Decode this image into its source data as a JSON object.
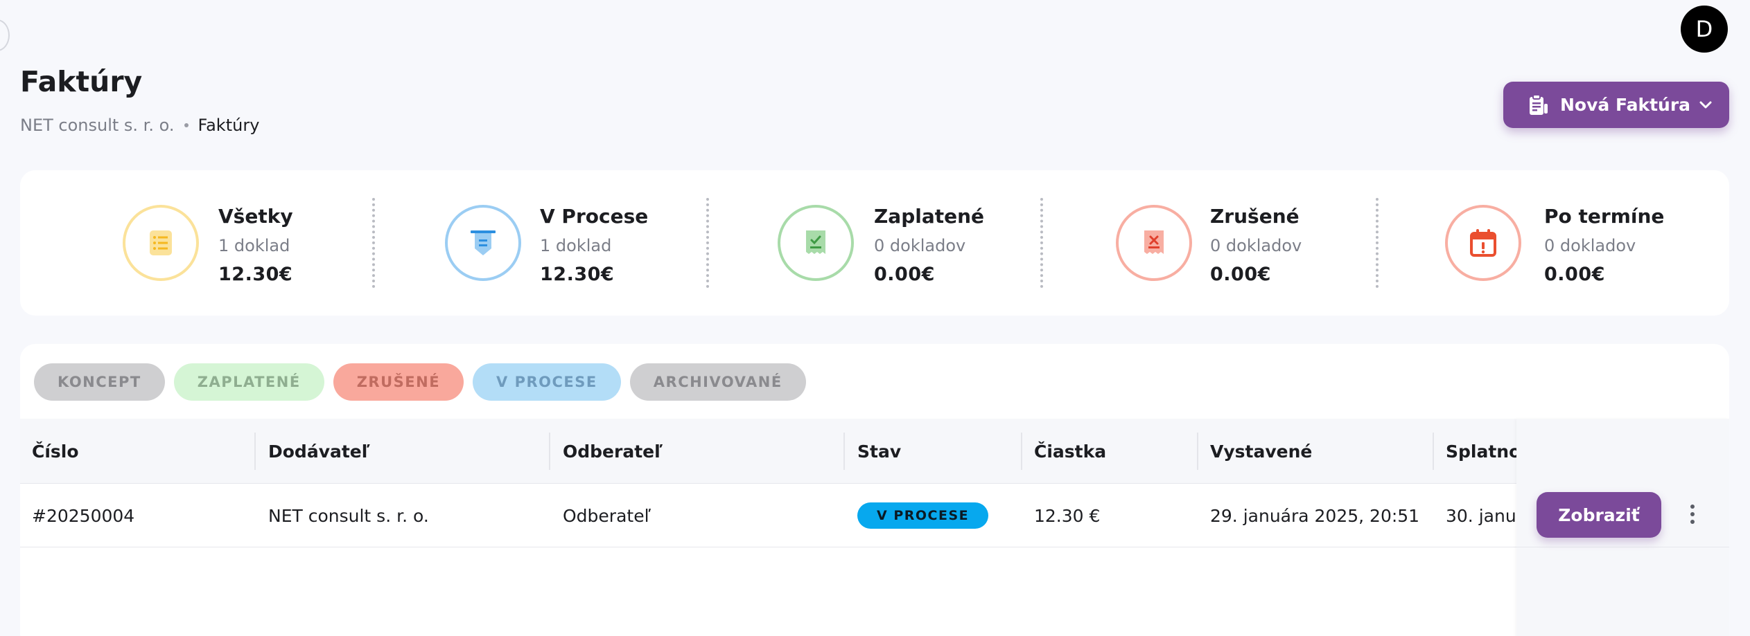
{
  "header": {
    "avatar_initial": "D",
    "title": "Faktúry",
    "breadcrumb": [
      "NET consult s. r. o.",
      "Faktúry"
    ],
    "new_invoice_button": "Nová Faktúra"
  },
  "stats": [
    {
      "title": "Všetky",
      "count": "1 doklad",
      "amount": "12.30€",
      "color": "#fbe29a",
      "icon": "document-list-icon"
    },
    {
      "title": "V Procese",
      "count": "1 doklad",
      "amount": "12.30€",
      "color": "#9bcdf3",
      "icon": "file-pending-icon"
    },
    {
      "title": "Zaplatené",
      "count": "0 dokladov",
      "amount": "0.00€",
      "color": "#a8dba9",
      "icon": "receipt-check-icon"
    },
    {
      "title": "Zrušené",
      "count": "0 dokladov",
      "amount": "0.00€",
      "color": "#f8aea2",
      "icon": "receipt-cancel-icon"
    },
    {
      "title": "Po termíne",
      "count": "0 dokladov",
      "amount": "0.00€",
      "color": "#f8aea2",
      "icon": "calendar-alert-icon"
    }
  ],
  "filters": [
    "KONCEPT",
    "ZAPLATENÉ",
    "ZRUŠENÉ",
    "V PROCESE",
    "ARCHIVOVANÉ"
  ],
  "table": {
    "columns": [
      "Číslo",
      "Dodávateľ",
      "Odberateľ",
      "Stav",
      "Čiastka",
      "Vystavené",
      "Splatnos"
    ],
    "rows": [
      {
        "cislo": "#20250004",
        "dodavatel": "NET consult s. r. o.",
        "odberatel": "Odberateľ",
        "stav": "V PROCESE",
        "ciastka": "12.30 €",
        "vystavene": "29. januára 2025, 20:51",
        "splatnost": "30. janu",
        "action": "Zobraziť"
      }
    ]
  },
  "colors": {
    "accent": "#7b4a9a",
    "status_in_progress": "#07a8ee"
  }
}
